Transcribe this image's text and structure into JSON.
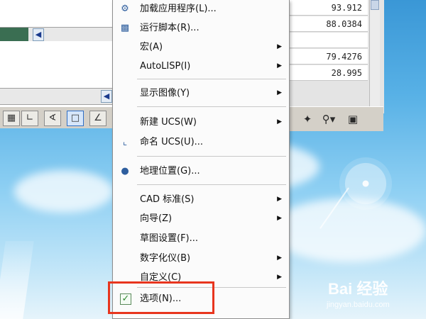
{
  "menu": {
    "items": [
      {
        "label": "加载应用程序(L)...",
        "icon": "load-app-icon",
        "submenu": false
      },
      {
        "label": "运行脚本(R)...",
        "icon": "run-script-icon",
        "submenu": false
      },
      {
        "label": "宏(A)",
        "icon": "",
        "submenu": true
      },
      {
        "label": "AutoLISP(I)",
        "icon": "",
        "submenu": true
      },
      {
        "label": "显示图像(Y)",
        "icon": "",
        "submenu": true
      },
      {
        "label": "新建 UCS(W)",
        "icon": "",
        "submenu": true
      },
      {
        "label": "命名 UCS(U)...",
        "icon": "named-ucs-icon",
        "submenu": false
      },
      {
        "label": "地理位置(G)...",
        "icon": "globe-icon",
        "submenu": false
      },
      {
        "label": "CAD 标准(S)",
        "icon": "",
        "submenu": true
      },
      {
        "label": "向导(Z)",
        "icon": "",
        "submenu": true
      },
      {
        "label": "草图设置(F)...",
        "icon": "",
        "submenu": false
      },
      {
        "label": "数字化仪(B)",
        "icon": "",
        "submenu": true
      },
      {
        "label": "自定义(C)",
        "icon": "",
        "submenu": true
      },
      {
        "label": "选项(N)...",
        "icon": "checkbox-icon",
        "submenu": false
      }
    ]
  },
  "properties": {
    "values": [
      "93.912",
      "88.0384",
      "",
      "79.4276",
      "28.995"
    ]
  },
  "watermark": {
    "brand": "Bai 经验",
    "url": "jingyan.baidu.com"
  },
  "colors": {
    "highlight": "#e8351e",
    "menu_bg": "#fbfbfb",
    "sky": "#58b1e6"
  }
}
